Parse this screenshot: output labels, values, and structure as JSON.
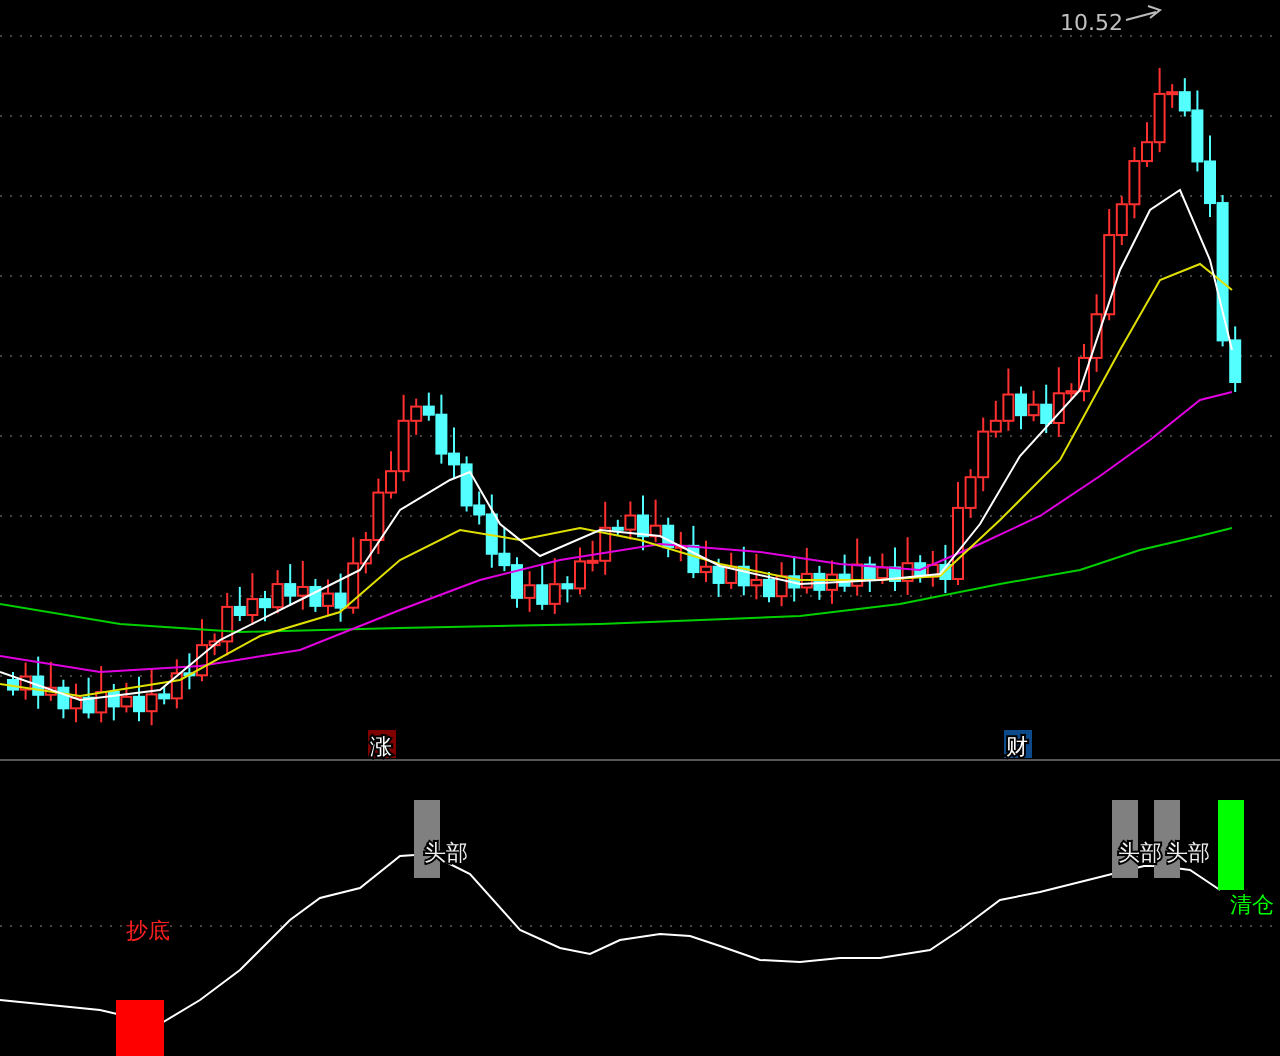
{
  "price_chart": {
    "peak_label": "10.52"
  },
  "event_markers": [
    {
      "text": "涨",
      "color": "#800000"
    },
    {
      "text": "财",
      "color": "#0c4a8c"
    }
  ],
  "indicator_signals": [
    {
      "kind": "bottom",
      "text": "抄底"
    },
    {
      "kind": "top",
      "text": "头部"
    },
    {
      "kind": "top",
      "text": "头部"
    },
    {
      "kind": "top",
      "text": "头部"
    },
    {
      "kind": "exit",
      "text": "清仓"
    }
  ]
}
